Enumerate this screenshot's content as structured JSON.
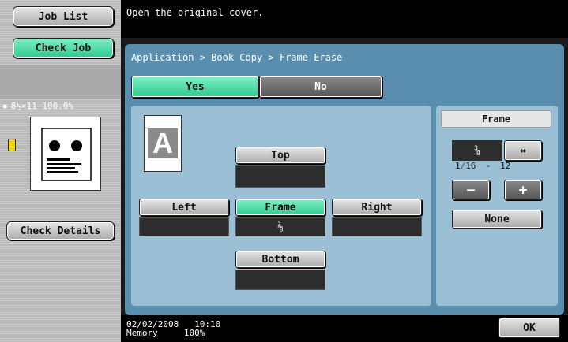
{
  "sidebar": {
    "job_list": "Job List",
    "check_job": "Check Job",
    "status_line": "8½×11  100.0%",
    "check_details": "Check Details"
  },
  "message": "Open the original cover.",
  "breadcrumb": "Application > Book Copy > Frame Erase",
  "toggle": {
    "yes": "Yes",
    "no": "No",
    "selected": "Yes"
  },
  "positions": {
    "top": "Top",
    "left": "Left",
    "frame": "Frame",
    "right": "Right",
    "bottom": "Bottom",
    "frame_value": "⅜",
    "top_value": "",
    "left_value": "",
    "right_value": "",
    "bottom_value": ""
  },
  "settings": {
    "title": "Frame",
    "value": "⅜",
    "range_min": "1⁄16",
    "range_sep": "-",
    "range_max": "12",
    "swap_icon": "⇔",
    "minus": "−",
    "plus": "+",
    "none": "None"
  },
  "footer": {
    "date": "02/02/2008",
    "time": "10:10",
    "memory_label": "Memory",
    "memory_value": "100%",
    "ok": "OK"
  },
  "colors": {
    "accent": "#2fc98e",
    "panel": "#5a8eaf",
    "subpanel": "#9bbfd4"
  }
}
